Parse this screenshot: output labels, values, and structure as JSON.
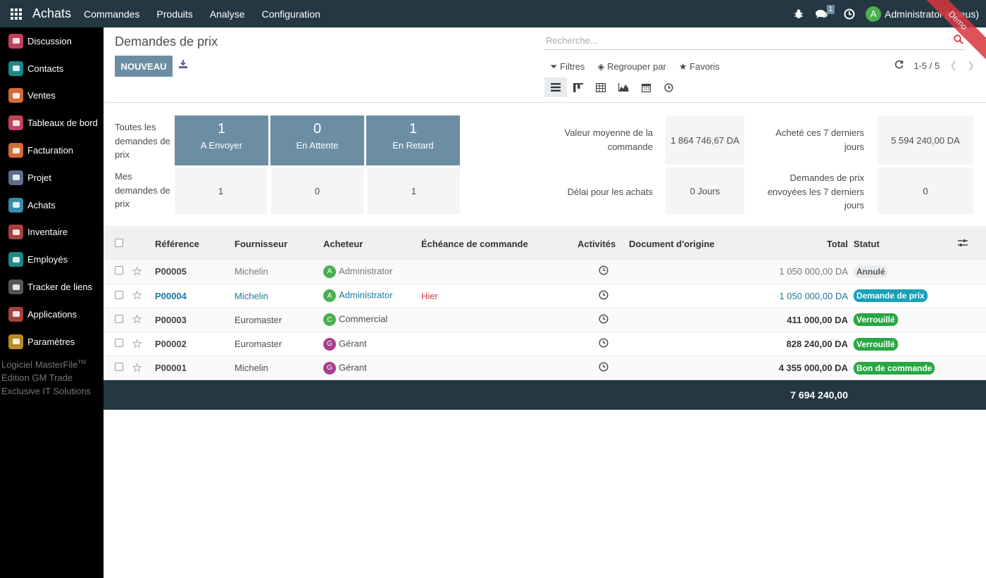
{
  "topbar": {
    "app": "Achats",
    "menus": [
      "Commandes",
      "Produits",
      "Analyse",
      "Configuration"
    ],
    "chat_badge": "1",
    "avatar_letter": "A",
    "user": "Administrator (pneus)",
    "ribbon": "Demo"
  },
  "sidebar": {
    "items": [
      {
        "label": "Discussion",
        "color": "#c0415a"
      },
      {
        "label": "Contacts",
        "color": "#1d8a8a"
      },
      {
        "label": "Ventes",
        "color": "#d36b37"
      },
      {
        "label": "Tableaux de bord",
        "color": "#c0415a"
      },
      {
        "label": "Facturation",
        "color": "#d36b37"
      },
      {
        "label": "Projet",
        "color": "#5a6f8e"
      },
      {
        "label": "Achats",
        "color": "#3b8aa8"
      },
      {
        "label": "Inventaire",
        "color": "#a8403e"
      },
      {
        "label": "Employés",
        "color": "#1d8a8a"
      },
      {
        "label": "Tracker de liens",
        "color": "#555555"
      },
      {
        "label": "Applications",
        "color": "#a8403e"
      },
      {
        "label": "Paramètres",
        "color": "#b88c24"
      }
    ],
    "footer": {
      "line1": "Logiciel MasterFile",
      "tm": "TM",
      "line2": "Edition GM Trade",
      "line3": "Exclusive IT Solutions"
    }
  },
  "control_panel": {
    "breadcrumb": "Demandes de prix",
    "new_button": "NOUVEAU",
    "search_placeholder": "Recherche...",
    "filters": "Filtres",
    "groupby": "Regrouper par",
    "favorites": "Favoris",
    "pager": "1-5 / 5"
  },
  "dashboard": {
    "all_label": "Toutes les demandes de prix",
    "my_label": "Mes demandes de prix",
    "tiles": [
      {
        "value": "1",
        "label": "A Envoyer"
      },
      {
        "value": "0",
        "label": "En Attente"
      },
      {
        "value": "1",
        "label": "En Retard"
      }
    ],
    "my_values": [
      "1",
      "0",
      "1"
    ],
    "stats": [
      {
        "label": "Valeur moyenne de la commande",
        "value": "1 864 746,67 DA"
      },
      {
        "label": "Acheté ces 7 derniers jours",
        "value": "5 594 240,00 DA"
      },
      {
        "label": "Délai pour les achats",
        "value": "0 Jours"
      },
      {
        "label": "Demandes de prix envoyées les 7 derniers jours",
        "value": "0"
      }
    ]
  },
  "table": {
    "headers": {
      "reference": "Référence",
      "supplier": "Fournisseur",
      "buyer": "Acheteur",
      "deadline": "Échéance de commande",
      "activities": "Activités",
      "origin": "Document d'origine",
      "total": "Total",
      "status": "Statut"
    },
    "rows": [
      {
        "ref": "P00005",
        "supplier": "Michelin",
        "buyer_initial": "A",
        "buyer_color": "#4caf50",
        "buyer": "Administrator",
        "deadline": "",
        "total": "1 050 000,00 DA",
        "status": "Annulé",
        "status_color": "#e9ecef",
        "style": "muted"
      },
      {
        "ref": "P00004",
        "supplier": "Michelin",
        "buyer_initial": "A",
        "buyer_color": "#4caf50",
        "buyer": "Administrator",
        "deadline": "Hier",
        "total": "1 050 000,00 DA",
        "status": "Demande de prix",
        "status_color": "#17a2b8",
        "style": "link"
      },
      {
        "ref": "P00003",
        "supplier": "Euromaster",
        "buyer_initial": "C",
        "buyer_color": "#4caf50",
        "buyer": "Commercial",
        "deadline": "",
        "total": "411 000,00 DA",
        "status": "Verrouillé",
        "status_color": "#28a745",
        "style": "normal"
      },
      {
        "ref": "P00002",
        "supplier": "Euromaster",
        "buyer_initial": "G",
        "buyer_color": "#a8408b",
        "buyer": "Gérant",
        "deadline": "",
        "total": "828 240,00 DA",
        "status": "Verrouillé",
        "status_color": "#28a745",
        "style": "normal"
      },
      {
        "ref": "P00001",
        "supplier": "Michelin",
        "buyer_initial": "G",
        "buyer_color": "#a8408b",
        "buyer": "Gérant",
        "deadline": "",
        "total": "4 355 000,00 DA",
        "status": "Bon de commande",
        "status_color": "#28a745",
        "style": "normal"
      }
    ],
    "footer_total": "7 694 240,00"
  }
}
